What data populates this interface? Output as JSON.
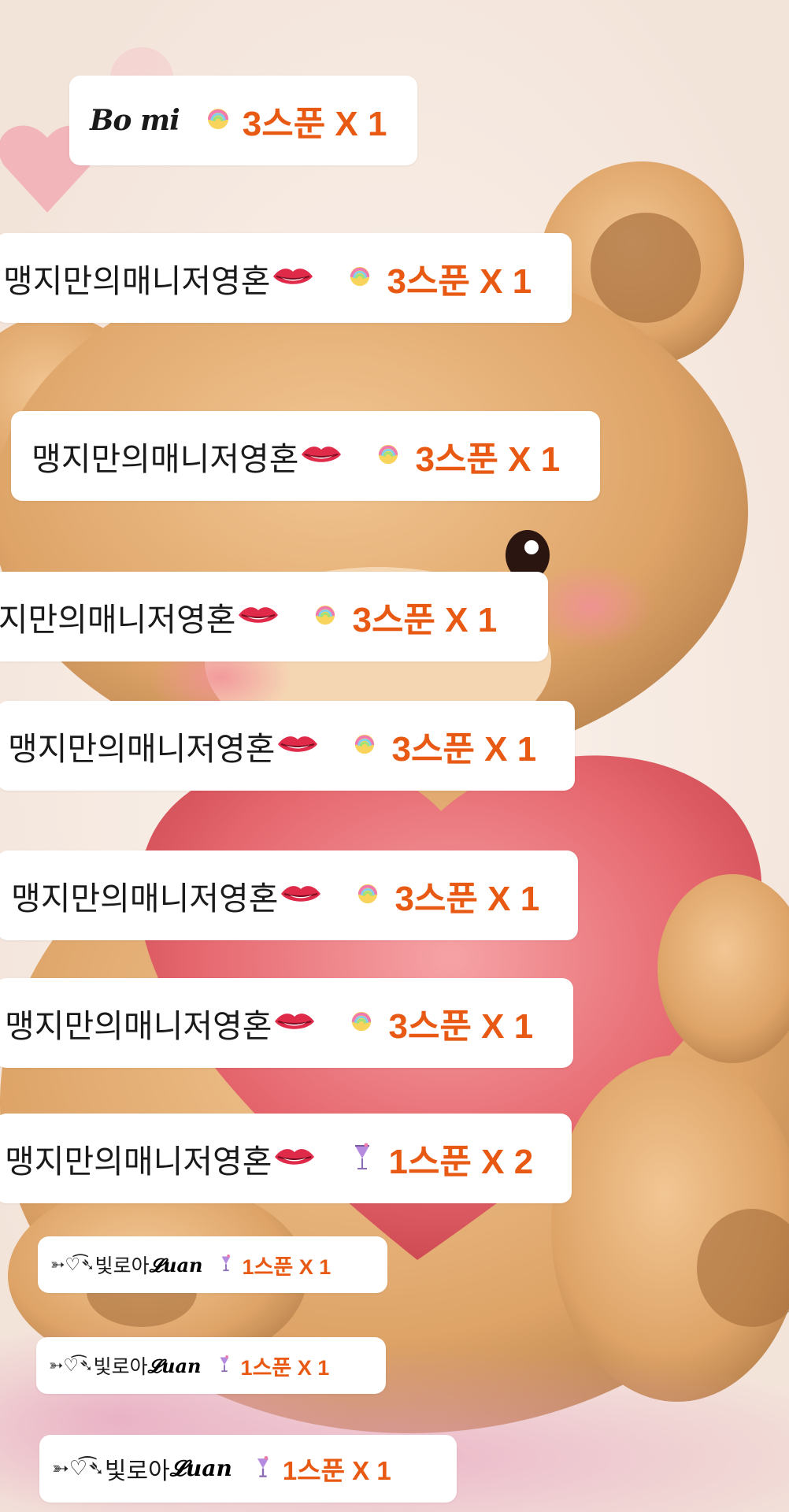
{
  "rows": [
    {
      "name": "𝑩𝒐 𝒎𝒊",
      "amount": "3스푼 X 1"
    },
    {
      "name": "맹지만의매니저영혼",
      "amount": "3스푼 X 1"
    },
    {
      "name": "맹지만의매니저영혼",
      "amount": "3스푼 X 1"
    },
    {
      "name": "맹지만의매니저영혼",
      "amount": "3스푼 X 1"
    },
    {
      "name": "맹지만의매니저영혼",
      "amount": "3스푼 X 1"
    },
    {
      "name": "맹지만의매니저영혼",
      "amount": "3스푼 X 1"
    },
    {
      "name": "맹지만의매니저영혼",
      "amount": "3스푼 X 1"
    },
    {
      "name": "맹지만의매니저영혼",
      "amount": "1스푼 X 2"
    },
    {
      "name_prefix": "➳♡͡➴",
      "name_main": "빛로아",
      "name_suffix": "𝓛uan",
      "amount": "1스푼 X 1"
    },
    {
      "name_prefix": "➳♡͡➴",
      "name_main": "빛로아",
      "name_suffix": "𝓛uan",
      "amount": "1스푼 X 1"
    },
    {
      "name_prefix": "➳♡͡➴",
      "name_main": "빛로아",
      "name_suffix": "𝓛uan",
      "amount": "1스푼 X 1"
    }
  ],
  "icons": {
    "lips": "lips-emoji-icon",
    "rainbow": "rainbow-sweet-icon",
    "cocktail": "cocktail-glass-icon"
  },
  "colors": {
    "amount": "#e85a14",
    "pill_bg": "#ffffff"
  }
}
